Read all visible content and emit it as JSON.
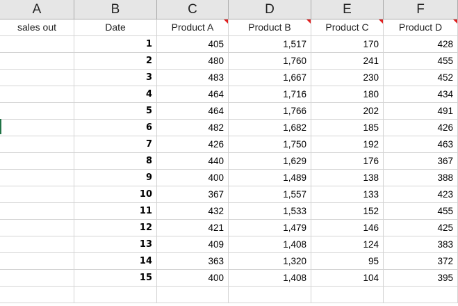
{
  "sheet": {
    "column_letters": [
      "A",
      "B",
      "C",
      "D",
      "E",
      "F"
    ],
    "headers": [
      "sales out",
      "Date",
      "Product A",
      "Product B",
      "Product C",
      "Product D"
    ],
    "rows": [
      [
        "",
        "1",
        "405",
        "1,517",
        "170",
        "428"
      ],
      [
        "",
        "2",
        "480",
        "1,760",
        "241",
        "455"
      ],
      [
        "",
        "3",
        "483",
        "1,667",
        "230",
        "452"
      ],
      [
        "",
        "4",
        "464",
        "1,716",
        "180",
        "434"
      ],
      [
        "",
        "5",
        "464",
        "1,766",
        "202",
        "491"
      ],
      [
        "",
        "6",
        "482",
        "1,682",
        "185",
        "426"
      ],
      [
        "",
        "7",
        "426",
        "1,750",
        "192",
        "463"
      ],
      [
        "",
        "8",
        "440",
        "1,629",
        "176",
        "367"
      ],
      [
        "",
        "9",
        "400",
        "1,489",
        "138",
        "388"
      ],
      [
        "",
        "10",
        "367",
        "1,557",
        "133",
        "423"
      ],
      [
        "",
        "11",
        "432",
        "1,533",
        "152",
        "455"
      ],
      [
        "",
        "12",
        "421",
        "1,479",
        "146",
        "425"
      ],
      [
        "",
        "13",
        "409",
        "1,408",
        "124",
        "383"
      ],
      [
        "",
        "14",
        "363",
        "1,320",
        "95",
        "372"
      ],
      [
        "",
        "15",
        "400",
        "1,408",
        "104",
        "395"
      ]
    ]
  }
}
